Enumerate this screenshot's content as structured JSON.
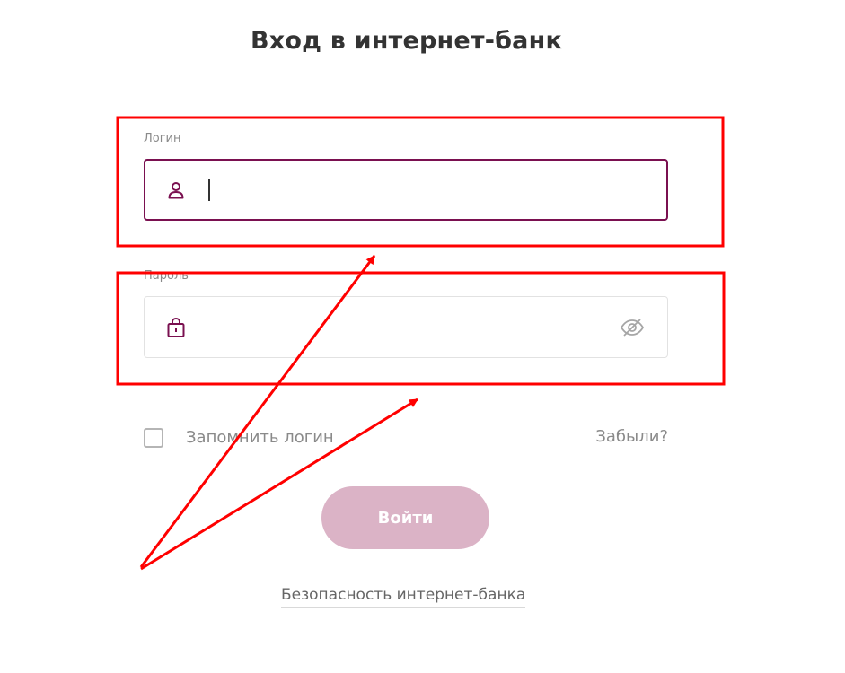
{
  "page": {
    "title": "Вход в интернет-банк"
  },
  "login": {
    "label": "Логин",
    "value": "",
    "icon": "user-icon"
  },
  "password": {
    "label": "Пароль",
    "value": "",
    "icon": "lock-icon",
    "toggle_icon": "eye-slash-icon"
  },
  "remember": {
    "label": "Запомнить логин",
    "checked": false
  },
  "forgot": {
    "label": "Забыли?"
  },
  "submit": {
    "label": "Войти"
  },
  "security": {
    "label": "Безопасность интернет-банка"
  },
  "colors": {
    "brand": "#7a1050",
    "button_disabled": "#dbb3c6",
    "annotation": "#ff0000"
  },
  "annotations": {
    "highlight_boxes": 2,
    "arrows": 2,
    "color": "#ff0000"
  }
}
